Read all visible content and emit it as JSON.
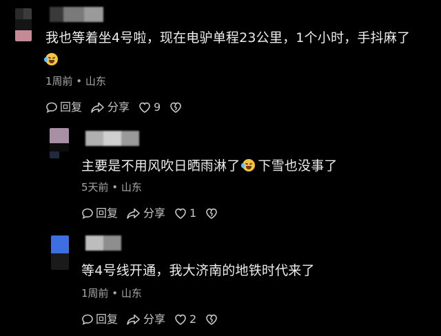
{
  "comments": [
    {
      "text_before_emoji": "我也等着坐4号啦，现在电驴单程23公里，1个小时，手抖麻了",
      "text_after_emoji": "",
      "meta": "1周前 • 山东",
      "reply_label": "回复",
      "share_label": "分享",
      "like_count": "9"
    },
    {
      "text_before_emoji": "主要是不用风吹日晒雨淋了",
      "text_after_emoji": "下雪也没事了",
      "meta": "5天前 • 山东",
      "reply_label": "回复",
      "share_label": "分享",
      "like_count": "1"
    },
    {
      "text_before_emoji": "等4号线开通，我大济南的地铁时代来了",
      "text_after_emoji": "",
      "meta": "1周前 • 山东",
      "reply_label": "回复",
      "share_label": "分享",
      "like_count": "2"
    }
  ],
  "icons": {
    "reply": "comment-bubble-icon",
    "share": "share-arrow-icon",
    "like": "heart-outline-icon",
    "dislike": "broken-heart-icon",
    "emoji": "crying-laughing-emoji"
  },
  "colors": {
    "background": "#000000",
    "text": "#ededed",
    "meta": "#a8a8a8",
    "action": "#c8c8c8"
  }
}
